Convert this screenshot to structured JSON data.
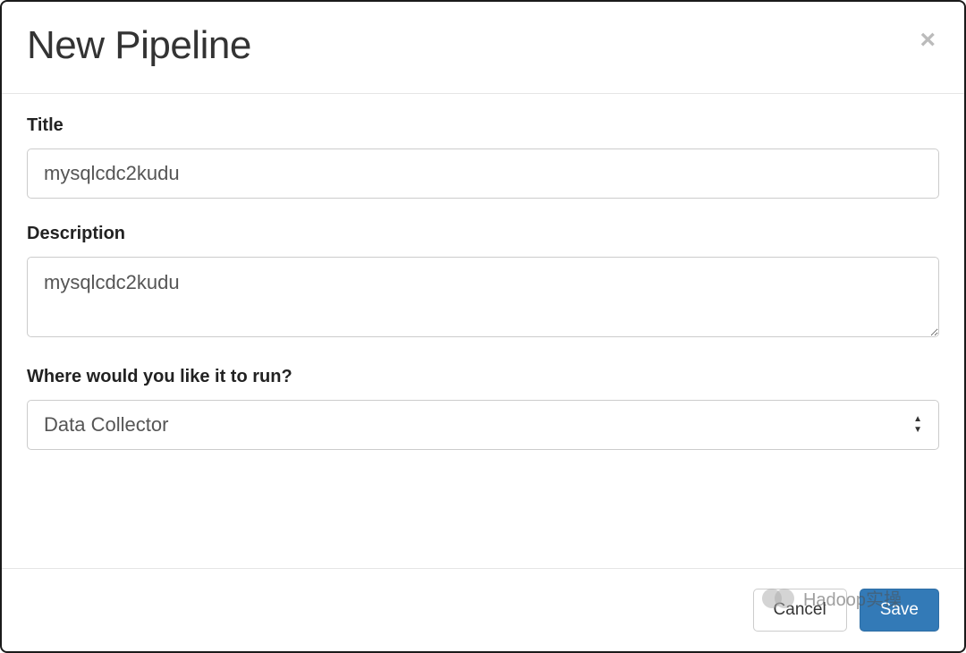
{
  "header": {
    "title": "New Pipeline",
    "close": "×"
  },
  "form": {
    "title_label": "Title",
    "title_value": "mysqlcdc2kudu",
    "description_label": "Description",
    "description_value": "mysqlcdc2kudu",
    "run_label": "Where would you like it to run?",
    "run_value": "Data Collector"
  },
  "footer": {
    "cancel": "Cancel",
    "save": "Save"
  },
  "watermark": {
    "text": "Hadoop实操"
  }
}
